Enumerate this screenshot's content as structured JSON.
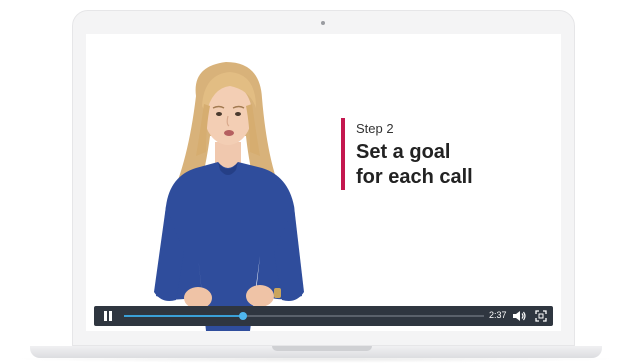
{
  "slide": {
    "step_label": "Step 2",
    "title_line1": "Set a goal",
    "title_line2": "for each call",
    "accent_color": "#c4184f"
  },
  "player": {
    "time_label": "2:37",
    "progress_fraction": 0.33,
    "icons": {
      "play_pause": "pause-icon",
      "volume": "volume-icon",
      "fullscreen": "fullscreen-icon"
    },
    "colors": {
      "bar": "#2f3640",
      "progress": "#3aa0d8"
    }
  },
  "presenter": {
    "description_icon": "presenter-video-frame"
  }
}
